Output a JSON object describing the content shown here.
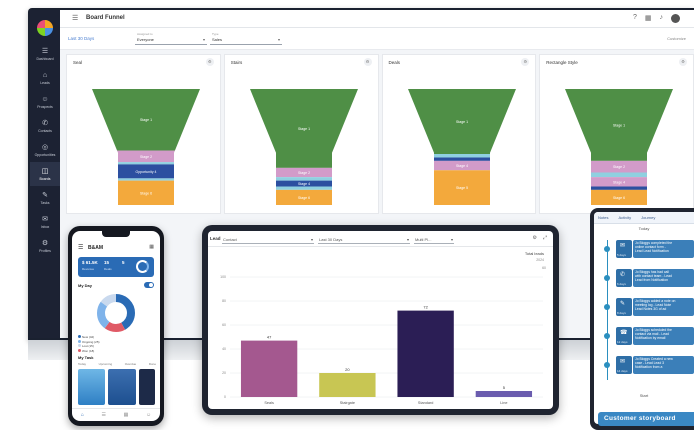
{
  "desktop": {
    "title": "Board Funnel",
    "nav": [
      {
        "icon": "☰",
        "label": "Dashboard"
      },
      {
        "icon": "⌂",
        "label": "Leads"
      },
      {
        "icon": "☺",
        "label": "Prospects"
      },
      {
        "icon": "✆",
        "label": "Contacts"
      },
      {
        "icon": "◎",
        "label": "Opportunities"
      },
      {
        "icon": "◫",
        "label": "Boards",
        "active": true
      },
      {
        "icon": "✎",
        "label": "Tasks"
      },
      {
        "icon": "✉",
        "label": "Inbox"
      },
      {
        "icon": "⚙",
        "label": "Profiles"
      }
    ],
    "filter": {
      "link": "Last 30 Days",
      "select1": {
        "caption": "Assigned to",
        "value": "Everyone"
      },
      "select2": {
        "caption": "Type",
        "value": "Sales"
      },
      "right_link": "Customize"
    },
    "funnels": [
      {
        "title": "Seal",
        "bands": [
          {
            "label": "Stage 1",
            "share": 0.53,
            "color": "#4f8f46"
          },
          {
            "label": "Stage 2",
            "share": 0.1,
            "color": "#d29bc9"
          },
          {
            "label": "",
            "share": 0.02,
            "color": "#8fd0e0"
          },
          {
            "label": "Opportunity 4",
            "share": 0.12,
            "color": "#2c4fa0"
          },
          {
            "label": "",
            "share": 0.02,
            "color": "#8fd0e0"
          },
          {
            "label": "Stage 6",
            "share": 0.21,
            "color": "#f3a93c"
          }
        ]
      },
      {
        "title": "Stairs",
        "bands": [
          {
            "label": "Stage 1",
            "share": 0.68,
            "color": "#4f8f46"
          },
          {
            "label": "Stage 2",
            "share": 0.08,
            "color": "#d29bc9"
          },
          {
            "label": "",
            "share": 0.03,
            "color": "#8fd0e0"
          },
          {
            "label": "Stage 4",
            "share": 0.05,
            "color": "#2c4fa0"
          },
          {
            "label": "",
            "share": 0.03,
            "color": "#8fd0e0"
          },
          {
            "label": "Stage 6",
            "share": 0.13,
            "color": "#f3a93c"
          }
        ]
      },
      {
        "title": "Deals",
        "bands": [
          {
            "label": "Stage 1",
            "share": 0.56,
            "color": "#4f8f46"
          },
          {
            "label": "",
            "share": 0.03,
            "color": "#8fd0e0"
          },
          {
            "label": "",
            "share": 0.03,
            "color": "#2c4fa0"
          },
          {
            "label": "Stage 4",
            "share": 0.08,
            "color": "#d29bc9"
          },
          {
            "label": "Stage 5",
            "share": 0.3,
            "color": "#f3a93c"
          }
        ]
      },
      {
        "title": "Rectangle Style",
        "bands": [
          {
            "label": "Stage 1",
            "share": 0.62,
            "color": "#4f8f46"
          },
          {
            "label": "Stage 2",
            "share": 0.1,
            "color": "#d29bc9"
          },
          {
            "label": "",
            "share": 0.04,
            "color": "#8fd0e0"
          },
          {
            "label": "Stage 4",
            "share": 0.08,
            "color": "#d29bc9"
          },
          {
            "label": "",
            "share": 0.03,
            "color": "#2c4fa0"
          },
          {
            "label": "Stage 6",
            "share": 0.13,
            "color": "#f3a93c"
          }
        ]
      }
    ]
  },
  "tablet": {
    "filter_label": "Lead",
    "select1": "Contact",
    "select2": "Last 30 Days",
    "select3": "Multi Pl...",
    "total_label": "Total leads",
    "total_sub": "2024",
    "legend_mark": "60"
  },
  "chart_data": {
    "type": "bar",
    "categories": [
      "Seals",
      "Stairgate",
      "Standard",
      "Line"
    ],
    "values": [
      47,
      20,
      72,
      5
    ],
    "value_labels": [
      "47",
      "20",
      "72",
      "5"
    ],
    "colors": [
      "#a4588f",
      "#c8c653",
      "#2b1e55",
      "#6a5cae"
    ],
    "ylim": [
      0,
      100
    ],
    "yticks": [
      0,
      20,
      40,
      60,
      80,
      100
    ]
  },
  "phone": {
    "title": "B&AM",
    "stat1_value": "$ 61.5K",
    "stat1_label": "Revenue",
    "stat2_value": "15",
    "stat2_label": "Deals",
    "stat3_value": "5",
    "section_title": "My Day",
    "donut": [
      {
        "label": "New (42)",
        "share": 0.42,
        "color": "#2a6bb5"
      },
      {
        "label": "Won",
        "share": 0.18,
        "color": "#e05a66"
      },
      {
        "label": "Ongoing",
        "share": 0.25,
        "color": "#7fb3ea"
      },
      {
        "label": "Lost",
        "share": 0.15,
        "color": "#c9d9ee"
      }
    ],
    "legend": [
      "New (42)",
      "Ongoing (25)",
      "Lost (15)",
      "Won (18)"
    ],
    "tasks_title": "My Task",
    "tabs": [
      "Today",
      "Upcoming",
      "Overdue",
      "Done"
    ]
  },
  "journey": {
    "tabs": [
      "Notes",
      "Activity",
      "Journey"
    ],
    "subtitle": "Today",
    "start_label": "Start",
    "banner": "Customer storyboard",
    "items": [
      {
        "glyph": "✉",
        "time": "5 days",
        "lines": [
          "Jo Bloggs completed the",
          "online contact form -",
          "Lead Lead Notification"
        ]
      },
      {
        "glyph": "✆",
        "time": "6 days",
        "lines": [
          "Jo Bloggs has had call",
          "with contact team - Lead",
          "Lead from Notification"
        ]
      },
      {
        "glyph": "✎",
        "time": "8 days",
        "lines": [
          "Jo Bloggs added a note on",
          "meeting log - Lead Note",
          "Lead Notes 3G of ad"
        ]
      },
      {
        "glyph": "☎",
        "time": "12 days",
        "lines": [
          "Jo Bloggs scheduled the",
          "contact via mail - Lead",
          "Notification by email"
        ]
      },
      {
        "glyph": "✉",
        "time": "14 days",
        "lines": [
          "Jo Bloggs Created a new",
          "case - Lead Lead 3",
          "Notification from a"
        ]
      }
    ]
  }
}
